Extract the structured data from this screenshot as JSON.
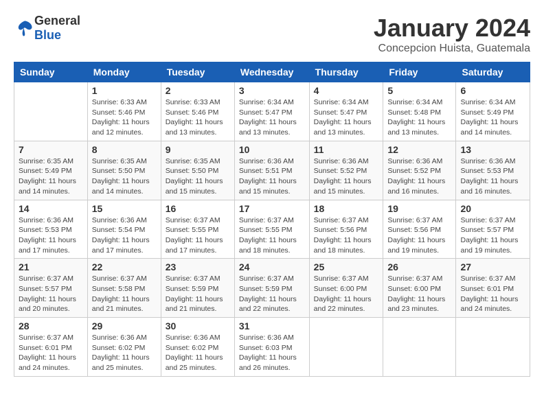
{
  "logo": {
    "text_general": "General",
    "text_blue": "Blue"
  },
  "header": {
    "title": "January 2024",
    "subtitle": "Concepcion Huista, Guatemala"
  },
  "weekdays": [
    "Sunday",
    "Monday",
    "Tuesday",
    "Wednesday",
    "Thursday",
    "Friday",
    "Saturday"
  ],
  "weeks": [
    [
      {
        "day": "",
        "info": ""
      },
      {
        "day": "1",
        "info": "Sunrise: 6:33 AM\nSunset: 5:46 PM\nDaylight: 11 hours\nand 12 minutes."
      },
      {
        "day": "2",
        "info": "Sunrise: 6:33 AM\nSunset: 5:46 PM\nDaylight: 11 hours\nand 13 minutes."
      },
      {
        "day": "3",
        "info": "Sunrise: 6:34 AM\nSunset: 5:47 PM\nDaylight: 11 hours\nand 13 minutes."
      },
      {
        "day": "4",
        "info": "Sunrise: 6:34 AM\nSunset: 5:47 PM\nDaylight: 11 hours\nand 13 minutes."
      },
      {
        "day": "5",
        "info": "Sunrise: 6:34 AM\nSunset: 5:48 PM\nDaylight: 11 hours\nand 13 minutes."
      },
      {
        "day": "6",
        "info": "Sunrise: 6:34 AM\nSunset: 5:49 PM\nDaylight: 11 hours\nand 14 minutes."
      }
    ],
    [
      {
        "day": "7",
        "info": "Sunrise: 6:35 AM\nSunset: 5:49 PM\nDaylight: 11 hours\nand 14 minutes."
      },
      {
        "day": "8",
        "info": "Sunrise: 6:35 AM\nSunset: 5:50 PM\nDaylight: 11 hours\nand 14 minutes."
      },
      {
        "day": "9",
        "info": "Sunrise: 6:35 AM\nSunset: 5:50 PM\nDaylight: 11 hours\nand 15 minutes."
      },
      {
        "day": "10",
        "info": "Sunrise: 6:36 AM\nSunset: 5:51 PM\nDaylight: 11 hours\nand 15 minutes."
      },
      {
        "day": "11",
        "info": "Sunrise: 6:36 AM\nSunset: 5:52 PM\nDaylight: 11 hours\nand 15 minutes."
      },
      {
        "day": "12",
        "info": "Sunrise: 6:36 AM\nSunset: 5:52 PM\nDaylight: 11 hours\nand 16 minutes."
      },
      {
        "day": "13",
        "info": "Sunrise: 6:36 AM\nSunset: 5:53 PM\nDaylight: 11 hours\nand 16 minutes."
      }
    ],
    [
      {
        "day": "14",
        "info": "Sunrise: 6:36 AM\nSunset: 5:53 PM\nDaylight: 11 hours\nand 17 minutes."
      },
      {
        "day": "15",
        "info": "Sunrise: 6:36 AM\nSunset: 5:54 PM\nDaylight: 11 hours\nand 17 minutes."
      },
      {
        "day": "16",
        "info": "Sunrise: 6:37 AM\nSunset: 5:55 PM\nDaylight: 11 hours\nand 17 minutes."
      },
      {
        "day": "17",
        "info": "Sunrise: 6:37 AM\nSunset: 5:55 PM\nDaylight: 11 hours\nand 18 minutes."
      },
      {
        "day": "18",
        "info": "Sunrise: 6:37 AM\nSunset: 5:56 PM\nDaylight: 11 hours\nand 18 minutes."
      },
      {
        "day": "19",
        "info": "Sunrise: 6:37 AM\nSunset: 5:56 PM\nDaylight: 11 hours\nand 19 minutes."
      },
      {
        "day": "20",
        "info": "Sunrise: 6:37 AM\nSunset: 5:57 PM\nDaylight: 11 hours\nand 19 minutes."
      }
    ],
    [
      {
        "day": "21",
        "info": "Sunrise: 6:37 AM\nSunset: 5:57 PM\nDaylight: 11 hours\nand 20 minutes."
      },
      {
        "day": "22",
        "info": "Sunrise: 6:37 AM\nSunset: 5:58 PM\nDaylight: 11 hours\nand 21 minutes."
      },
      {
        "day": "23",
        "info": "Sunrise: 6:37 AM\nSunset: 5:59 PM\nDaylight: 11 hours\nand 21 minutes."
      },
      {
        "day": "24",
        "info": "Sunrise: 6:37 AM\nSunset: 5:59 PM\nDaylight: 11 hours\nand 22 minutes."
      },
      {
        "day": "25",
        "info": "Sunrise: 6:37 AM\nSunset: 6:00 PM\nDaylight: 11 hours\nand 22 minutes."
      },
      {
        "day": "26",
        "info": "Sunrise: 6:37 AM\nSunset: 6:00 PM\nDaylight: 11 hours\nand 23 minutes."
      },
      {
        "day": "27",
        "info": "Sunrise: 6:37 AM\nSunset: 6:01 PM\nDaylight: 11 hours\nand 24 minutes."
      }
    ],
    [
      {
        "day": "28",
        "info": "Sunrise: 6:37 AM\nSunset: 6:01 PM\nDaylight: 11 hours\nand 24 minutes."
      },
      {
        "day": "29",
        "info": "Sunrise: 6:36 AM\nSunset: 6:02 PM\nDaylight: 11 hours\nand 25 minutes."
      },
      {
        "day": "30",
        "info": "Sunrise: 6:36 AM\nSunset: 6:02 PM\nDaylight: 11 hours\nand 25 minutes."
      },
      {
        "day": "31",
        "info": "Sunrise: 6:36 AM\nSunset: 6:03 PM\nDaylight: 11 hours\nand 26 minutes."
      },
      {
        "day": "",
        "info": ""
      },
      {
        "day": "",
        "info": ""
      },
      {
        "day": "",
        "info": ""
      }
    ]
  ]
}
